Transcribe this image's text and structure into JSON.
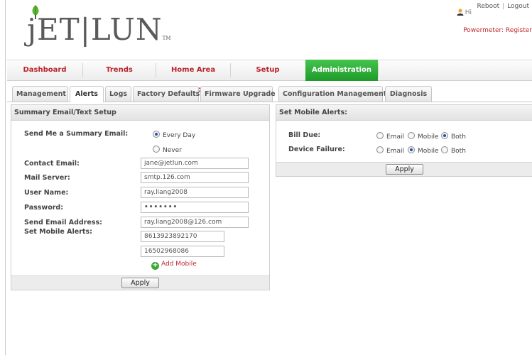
{
  "header": {
    "logo_text": "jET|LUN",
    "logo_tm": "TM",
    "reboot": "Reboot",
    "separator": "|",
    "logout": "Logout",
    "greeting": "Hi",
    "powermeter": "Powermeter: Register"
  },
  "nav": {
    "items": [
      "Dashboard",
      "Trends",
      "Home Area Network",
      "Setup",
      "Administration"
    ],
    "active": "Administration",
    "accent": "#2aab35",
    "label_color": "#b8232a"
  },
  "subtabs": {
    "items": [
      "Management",
      "Alerts",
      "Logs",
      "Factory Defaults",
      "Firmware Upgrade",
      "Configuration Management",
      "Diagnosis"
    ],
    "active": "Alerts"
  },
  "summary": {
    "title": "Summary Email/Text Setup",
    "send_label": "Send Me a Summary Email:",
    "every_day": "Every Day",
    "never": "Never",
    "selected": "Every Day",
    "contact_email_label": "Contact Email:",
    "contact_email": "jane@jetlun.com",
    "mail_server_label": "Mail Server:",
    "mail_server": "smtp.126.com",
    "user_name_label": "User Name:",
    "user_name": "ray.liang2008",
    "password_label": "Password:",
    "password": "•••••••",
    "send_email_label": "Send Email Address:",
    "send_email": "ray.liang2008@126.com",
    "mobile_alerts_label": "Set Mobile Alerts:",
    "mobile_1": "8613923892170",
    "mobile_2": "16502968086",
    "add_mobile": "Add Mobile",
    "apply": "Apply"
  },
  "mobile_alerts": {
    "title": "Set Mobile Alerts:",
    "options": [
      "Email",
      "Mobile",
      "Both"
    ],
    "bill_due_label": "Bill Due:",
    "bill_due_selected": "Both",
    "device_failure_label": "Device Failure:",
    "device_failure_selected": "Mobile",
    "apply": "Apply"
  }
}
